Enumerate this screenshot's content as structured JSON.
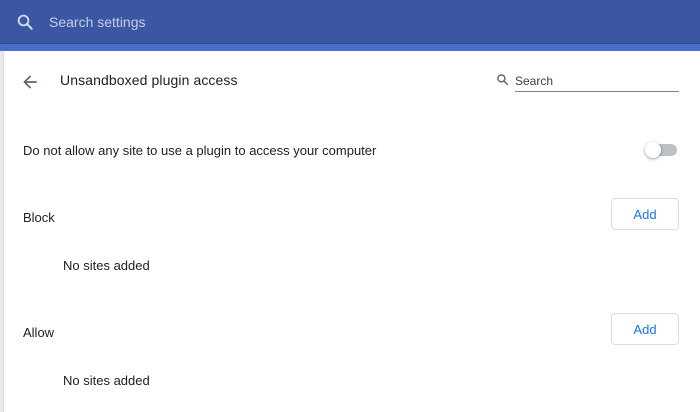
{
  "header": {
    "search_placeholder": "Search settings",
    "search_icon": "search-icon",
    "background": "#3b57a3"
  },
  "page": {
    "title": "Unsandboxed plugin access",
    "back_icon": "arrow-left-icon",
    "search_placeholder": "Search"
  },
  "setting": {
    "label": "Do not allow any site to use a plugin to access your computer",
    "enabled": false
  },
  "sections": {
    "block": {
      "label": "Block",
      "add_label": "Add",
      "empty_text": "No sites added"
    },
    "allow": {
      "label": "Allow",
      "add_label": "Add",
      "empty_text": "No sites added"
    }
  },
  "colors": {
    "accent": "#1a73e8",
    "toggle_off": "#bdc1c6"
  }
}
